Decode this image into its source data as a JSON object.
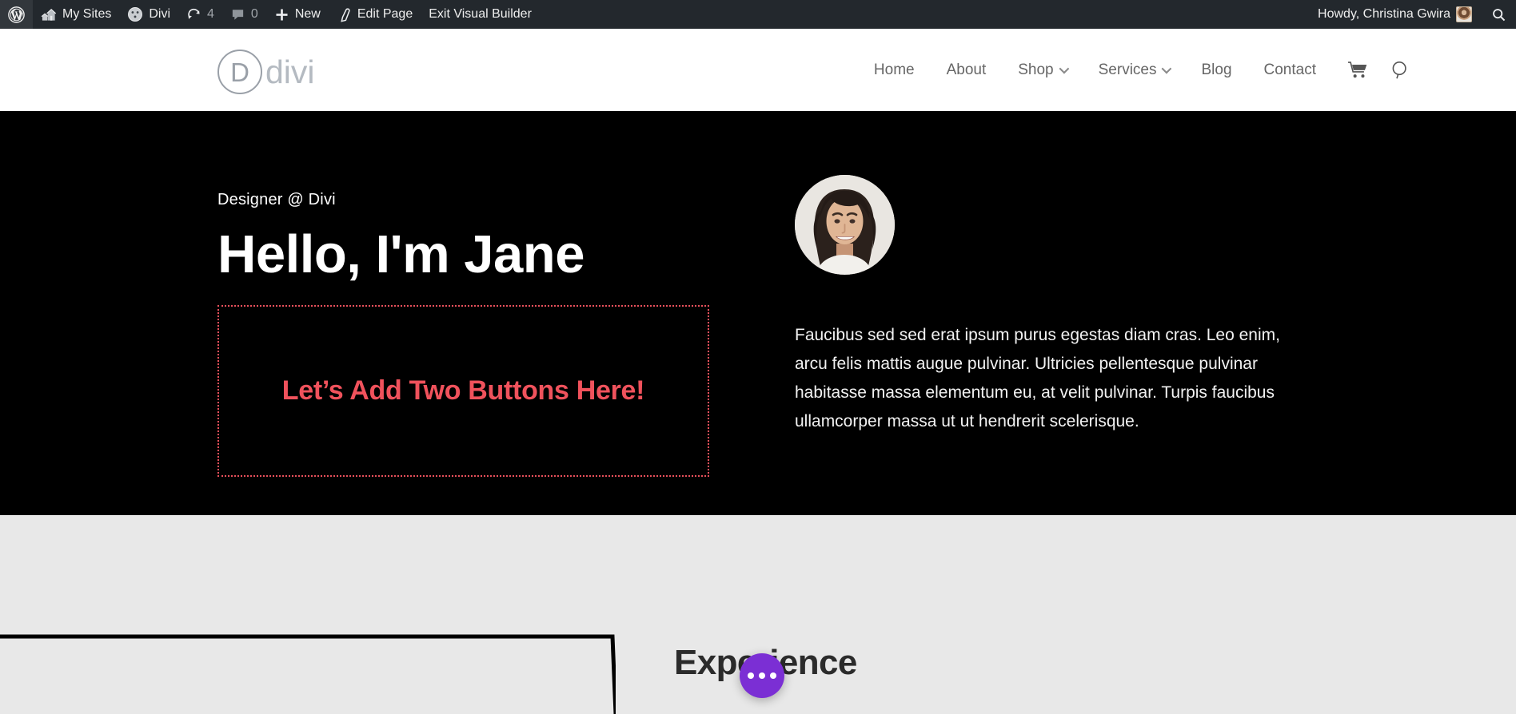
{
  "admin_bar": {
    "left_items": [
      {
        "icon": "wordpress-logo-icon",
        "label": ""
      },
      {
        "icon": "sites-icon",
        "label": "My Sites"
      },
      {
        "icon": "divi-dashboard-icon",
        "label": "Divi"
      },
      {
        "icon": "updates-icon",
        "label": "4"
      },
      {
        "icon": "comments-icon",
        "label": "0"
      },
      {
        "icon": "plus-icon",
        "label": "New"
      },
      {
        "icon": "pencil-icon",
        "label": "Edit Page"
      },
      {
        "icon": "",
        "label": "Exit Visual Builder"
      }
    ],
    "greeting": "Howdy, Christina Gwira",
    "search_icon": "search-icon"
  },
  "site_header": {
    "logo_letter": "D",
    "logo_word": "divi",
    "nav": [
      {
        "label": "Home",
        "has_submenu": false
      },
      {
        "label": "About",
        "has_submenu": false
      },
      {
        "label": "Shop",
        "has_submenu": true
      },
      {
        "label": "Services",
        "has_submenu": true
      },
      {
        "label": "Blog",
        "has_submenu": false
      },
      {
        "label": "Contact",
        "has_submenu": false
      }
    ],
    "icons": [
      {
        "name": "cart-icon"
      },
      {
        "name": "search-icon"
      }
    ]
  },
  "hero": {
    "eyebrow": "Designer @ Divi",
    "title": "Hello, I'm Jane",
    "placeholder_text": "Let’s Add Two Buttons Here!",
    "placeholder_border_color": "#e8505b",
    "placeholder_text_color": "#f0525c",
    "avatar_name": "avatar-photo",
    "paragraph": "Faucibus sed sed erat ipsum purus egestas diam cras. Leo enim, arcu felis mattis augue pulvinar. Ultricies pellentesque pulvinar habitasse massa elementum eu, at velit pulvinar. Turpis faucibus ullamcorper massa ut ut hendrerit scelerisque.",
    "background_color": "#000000"
  },
  "lower_section": {
    "heading": "Experience",
    "background_color": "#e8e8e8",
    "hover_outline_color": "#000000"
  },
  "fab": {
    "name": "divi-builder-menu-button",
    "color": "#7b2fd4",
    "dots": 3
  }
}
